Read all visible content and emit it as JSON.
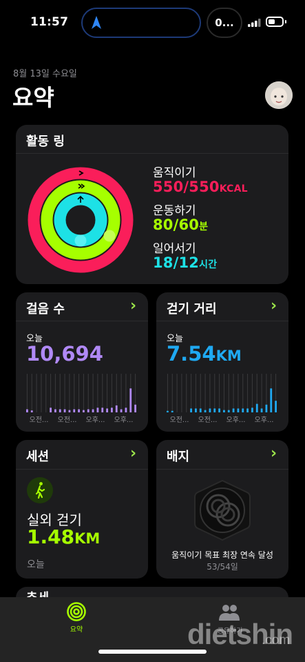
{
  "status_bar": {
    "time": "11:57",
    "activity_pill": "0..."
  },
  "header": {
    "date": "8월 13일 수요일",
    "title": "요약"
  },
  "activity_ring": {
    "title": "활동 링",
    "move": {
      "label": "움직이기",
      "value": "550/550",
      "unit": "KCAL",
      "color": "#fa1e5a",
      "progress": 1.0
    },
    "exercise": {
      "label": "운동하기",
      "value": "80/60",
      "unit": "분",
      "color": "#a6ff00",
      "progress": 1.33
    },
    "stand": {
      "label": "일어서기",
      "value": "18/12",
      "unit": "시간",
      "color": "#1de1e6",
      "progress": 1.5
    }
  },
  "steps": {
    "title": "걸음 수",
    "sub": "오늘",
    "value": "10,694",
    "color": "#b089f6",
    "axis": [
      "오전...",
      "오전...",
      "오후...",
      "오후..."
    ]
  },
  "distance": {
    "title": "걷기 거리",
    "sub": "오늘",
    "value": "7.54",
    "unit": "KM",
    "color": "#1fa9f2",
    "axis": [
      "오전...",
      "오전...",
      "오후...",
      "오후..."
    ]
  },
  "session": {
    "title": "세션",
    "workout": "실외 걷기",
    "value": "1.48",
    "unit": "KM",
    "sub": "오늘",
    "icon": "walking-figure-icon",
    "color": "#a6ff00"
  },
  "badges": {
    "title": "배지",
    "caption": "움직이기 목표 최장 연속 달성",
    "count": "53/54일",
    "icon": "award-badge-icon"
  },
  "next_card": {
    "title": "추세"
  },
  "tab_bar": {
    "summary": "요약",
    "sharing": "공유하기"
  },
  "watermark": {
    "main": "dietshin",
    "suffix": ".com"
  },
  "steps_bars": [
    0.08,
    0.05,
    0,
    0,
    0,
    0.12,
    0.08,
    0.08,
    0.08,
    0.06,
    0.08,
    0.08,
    0.06,
    0.08,
    0.08,
    0.12,
    0.12,
    0.1,
    0.12,
    0.18,
    0.08,
    0.12,
    0.62,
    0.2
  ],
  "distance_bars": [
    0.04,
    0.04,
    0,
    0,
    0,
    0.1,
    0.1,
    0.1,
    0.06,
    0.1,
    0.1,
    0.1,
    0.06,
    0.06,
    0.1,
    0.1,
    0.1,
    0.1,
    0.12,
    0.22,
    0.1,
    0.2,
    0.62,
    0.3
  ]
}
